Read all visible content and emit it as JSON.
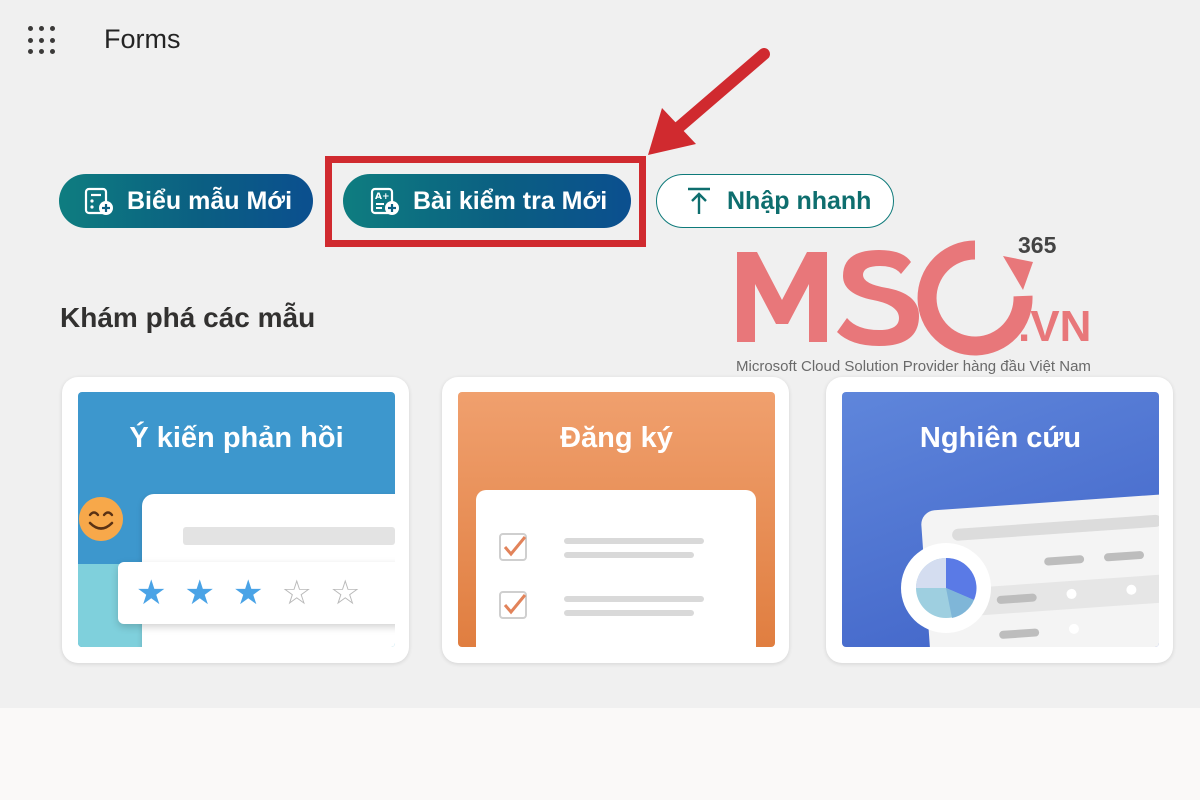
{
  "header": {
    "app_title": "Forms",
    "waffle_icon": "app-launcher-icon"
  },
  "toolbar": {
    "new_form_label": "Biểu mẫu Mới",
    "new_quiz_label": "Bài kiểm tra Mới",
    "quick_import_label": "Nhập nhanh",
    "new_form_icon": "form-add-icon",
    "new_quiz_icon": "quiz-add-icon",
    "quick_import_icon": "upload-icon"
  },
  "annotation": {
    "highlight_color": "#d02a2f"
  },
  "watermark": {
    "logo_text": "MSO",
    "logo_suffix": ".VN",
    "logo_superscript": "365",
    "caption": "Microsoft Cloud Solution Provider hàng đầu Việt Nam",
    "brand_color": "#e8777a"
  },
  "templates": {
    "section_title": "Khám phá các mẫu",
    "cards": [
      {
        "title": "Ý kiến phản hồi",
        "rating_filled": 3,
        "rating_total": 5
      },
      {
        "title": "Đăng ký"
      },
      {
        "title": "Nghiên cứu"
      }
    ]
  },
  "colors": {
    "primary_gradient_start": "#0e7d80",
    "primary_gradient_end": "#0b4f8f",
    "feedback_card": "#3d97cd",
    "registration_card": "#e07e40",
    "research_card": "#4f72d3"
  }
}
